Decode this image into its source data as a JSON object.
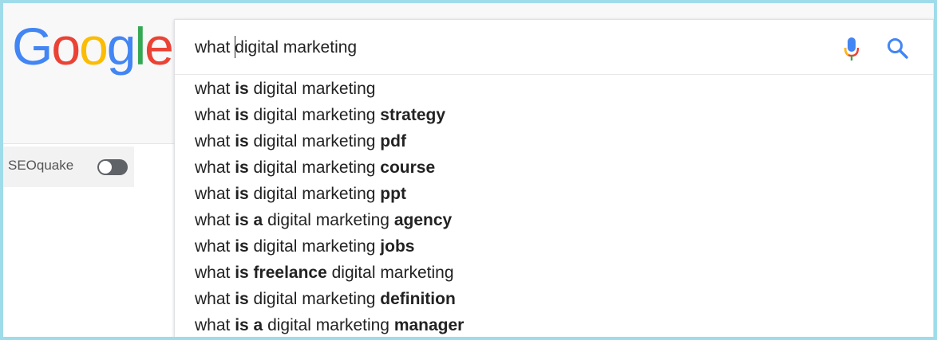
{
  "logo": {
    "letters": [
      "G",
      "o",
      "o",
      "g",
      "l",
      "e"
    ],
    "colors": [
      "#4285F4",
      "#EA4335",
      "#FBBC05",
      "#4285F4",
      "#34A853",
      "#EA4335"
    ]
  },
  "search": {
    "query": "what digital marketing",
    "icons": {
      "voice": "microphone-icon",
      "submit": "magnifier-icon"
    }
  },
  "sidebar": {
    "extension_label": "SEOquake",
    "toggle_state": "off"
  },
  "suggestions": [
    [
      {
        "t": "what ",
        "b": false
      },
      {
        "t": "is",
        "b": true
      },
      {
        "t": " digital marketing",
        "b": false
      }
    ],
    [
      {
        "t": "what ",
        "b": false
      },
      {
        "t": "is",
        "b": true
      },
      {
        "t": " digital marketing ",
        "b": false
      },
      {
        "t": "strategy",
        "b": true
      }
    ],
    [
      {
        "t": "what ",
        "b": false
      },
      {
        "t": "is",
        "b": true
      },
      {
        "t": " digital marketing ",
        "b": false
      },
      {
        "t": "pdf",
        "b": true
      }
    ],
    [
      {
        "t": "what ",
        "b": false
      },
      {
        "t": "is",
        "b": true
      },
      {
        "t": " digital marketing ",
        "b": false
      },
      {
        "t": "course",
        "b": true
      }
    ],
    [
      {
        "t": "what ",
        "b": false
      },
      {
        "t": "is",
        "b": true
      },
      {
        "t": " digital marketing ",
        "b": false
      },
      {
        "t": "ppt",
        "b": true
      }
    ],
    [
      {
        "t": "what ",
        "b": false
      },
      {
        "t": "is a",
        "b": true
      },
      {
        "t": " digital marketing ",
        "b": false
      },
      {
        "t": "agency",
        "b": true
      }
    ],
    [
      {
        "t": "what ",
        "b": false
      },
      {
        "t": "is",
        "b": true
      },
      {
        "t": " digital marketing ",
        "b": false
      },
      {
        "t": "jobs",
        "b": true
      }
    ],
    [
      {
        "t": "what ",
        "b": false
      },
      {
        "t": "is freelance",
        "b": true
      },
      {
        "t": " digital marketing",
        "b": false
      }
    ],
    [
      {
        "t": "what ",
        "b": false
      },
      {
        "t": "is",
        "b": true
      },
      {
        "t": " digital marketing ",
        "b": false
      },
      {
        "t": "definition",
        "b": true
      }
    ],
    [
      {
        "t": "what ",
        "b": false
      },
      {
        "t": "is a",
        "b": true
      },
      {
        "t": " digital marketing ",
        "b": false
      },
      {
        "t": "manager",
        "b": true
      }
    ]
  ]
}
